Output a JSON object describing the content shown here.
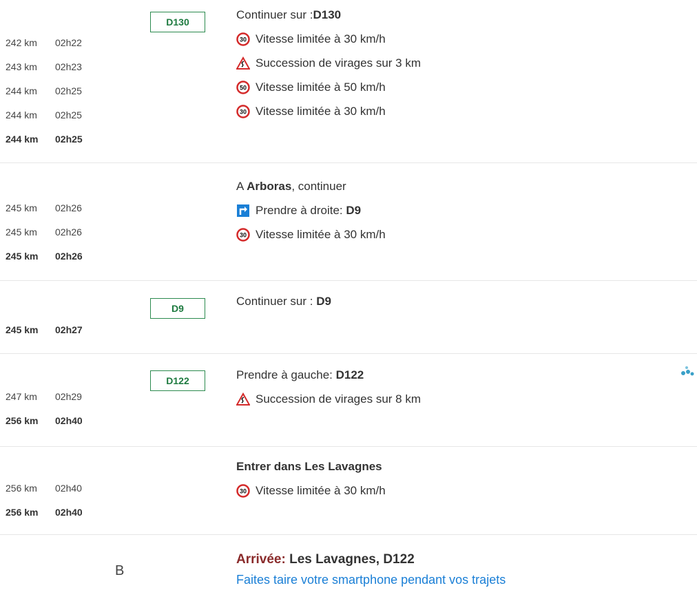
{
  "sections": [
    {
      "road_badge": "D130",
      "heading": {
        "pre": "Continuer sur : ",
        "bold": "D130",
        "post": ""
      },
      "steps": [
        {
          "icon": "speed-30-icon",
          "text": "Vitesse limitée à 30 km/h"
        },
        {
          "icon": "winding-road-warning-icon",
          "text": "Succession de virages sur 3 km"
        },
        {
          "icon": "speed-50-icon",
          "text": "Vitesse limitée à 50 km/h"
        },
        {
          "icon": "speed-30-icon",
          "text": "Vitesse limitée à 30 km/h"
        }
      ],
      "times": [
        {
          "km": "242 km",
          "time": "02h22"
        },
        {
          "km": "243 km",
          "time": "02h23"
        },
        {
          "km": "244 km",
          "time": "02h25"
        },
        {
          "km": "244 km",
          "time": "02h25"
        }
      ],
      "total": {
        "km": "244 km",
        "time": "02h25"
      }
    },
    {
      "heading": {
        "pre": "A ",
        "bold": "Arboras",
        "post": ", continuer"
      },
      "steps": [
        {
          "icon": "turn-right-icon",
          "text": "Prendre à droite: ",
          "bold": "D9"
        },
        {
          "icon": "speed-30-icon",
          "text": "Vitesse limitée à 30 km/h"
        }
      ],
      "times": [
        {
          "km": "245 km",
          "time": "02h26"
        },
        {
          "km": "245 km",
          "time": "02h26"
        }
      ],
      "total": {
        "km": "245 km",
        "time": "02h26"
      }
    },
    {
      "road_badge": "D9",
      "heading": {
        "pre": "Continuer sur : ",
        "bold": "D9",
        "post": ""
      },
      "total": {
        "km": "245 km",
        "time": "02h27"
      }
    },
    {
      "road_badge": "D122",
      "heading": {
        "pre": "Prendre à gauche: ",
        "bold": "D122",
        "post": ""
      },
      "steps": [
        {
          "icon": "winding-road-warning-icon",
          "text": "Succession de virages sur 8 km"
        }
      ],
      "times": [
        {
          "km": "247 km",
          "time": "02h29"
        }
      ],
      "total": {
        "km": "256 km",
        "time": "02h40"
      }
    },
    {
      "heading": {
        "pre": "",
        "bold": "Entrer dans Les Lavagnes",
        "post": ""
      },
      "steps": [
        {
          "icon": "speed-30-icon",
          "text": "Vitesse limitée à 30 km/h"
        }
      ],
      "times": [
        {
          "km": "256 km",
          "time": "02h40"
        }
      ],
      "total": {
        "km": "256 km",
        "time": "02h40"
      }
    }
  ],
  "arrival": {
    "marker": "B",
    "label": "Arrivée:",
    "destination": " Les Lavagnes, D122",
    "advice": "Faites taire votre smartphone pendant vos trajets"
  },
  "colors": {
    "badge_green": "#2b8a4e",
    "speed_red": "#d42a2a",
    "turn_blue": "#1a7fd6",
    "arrival_red": "#8a2b2b",
    "advice_blue": "#1a7fd6"
  }
}
